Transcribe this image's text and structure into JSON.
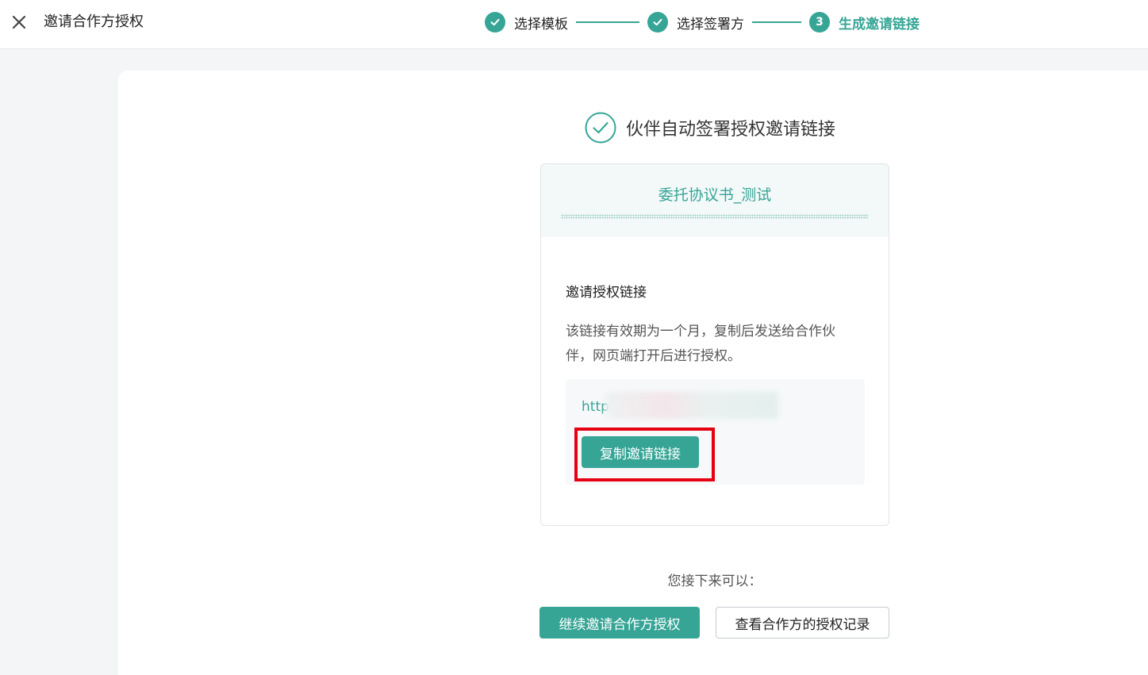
{
  "header": {
    "title": "邀请合作方授权",
    "close_icon": "close-icon"
  },
  "steps": [
    {
      "label": "选择模板",
      "status": "done"
    },
    {
      "label": "选择签署方",
      "status": "done"
    },
    {
      "label": "生成邀请链接",
      "status": "active",
      "number": "3"
    }
  ],
  "result": {
    "icon": "check-circle-icon",
    "title": "伙伴自动签署授权邀请链接"
  },
  "card": {
    "template_name": "委托协议书_测试",
    "section_title": "邀请授权链接",
    "description": "该链接有效期为一个月，复制后发送给合作伙伴，网页端打开后进行授权。",
    "link_prefix": "http",
    "copy_button": "复制邀请链接"
  },
  "next": {
    "label": "您接下来可以：",
    "primary_button": "继续邀请合作方授权",
    "secondary_button": "查看合作方的授权记录"
  },
  "colors": {
    "accent": "#36a596",
    "highlight": "#e60012"
  }
}
